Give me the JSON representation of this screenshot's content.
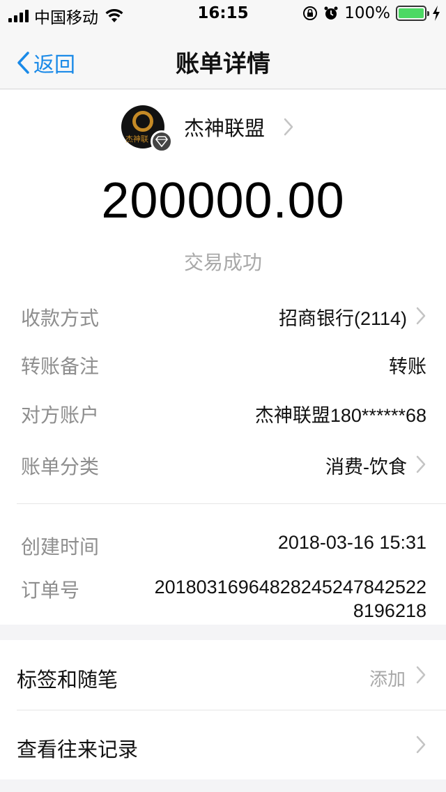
{
  "status_bar": {
    "carrier": "中国移动",
    "time": "16:15",
    "battery": "100%",
    "battery_level": 1.0
  },
  "nav": {
    "back_label": "返回",
    "title": "账单详情"
  },
  "merchant": {
    "name": "杰神联盟",
    "avatar_text": "杰神联"
  },
  "amount": "200000.00",
  "status": "交易成功",
  "details": [
    {
      "label": "收款方式",
      "value": "招商银行(2114)",
      "chevron": true
    },
    {
      "label": "转账备注",
      "value": "转账",
      "chevron": false
    },
    {
      "label": "对方账户",
      "value": "杰神联盟180******68",
      "chevron": false
    },
    {
      "label": "账单分类",
      "value": "消费-饮食",
      "chevron": true
    }
  ],
  "meta": {
    "created_label": "创建时间",
    "created_value": "2018-03-16 15:31",
    "order_label": "订单号",
    "order_value_line1": "20180316964828245247842522",
    "order_value_line2": "8196218"
  },
  "list": [
    {
      "label": "标签和随笔",
      "hint": "添加"
    },
    {
      "label": "查看往来记录",
      "hint": ""
    }
  ],
  "colors": {
    "accent": "#1a8ae8",
    "battery": "#4cd964",
    "muted": "#8e8e8e"
  }
}
